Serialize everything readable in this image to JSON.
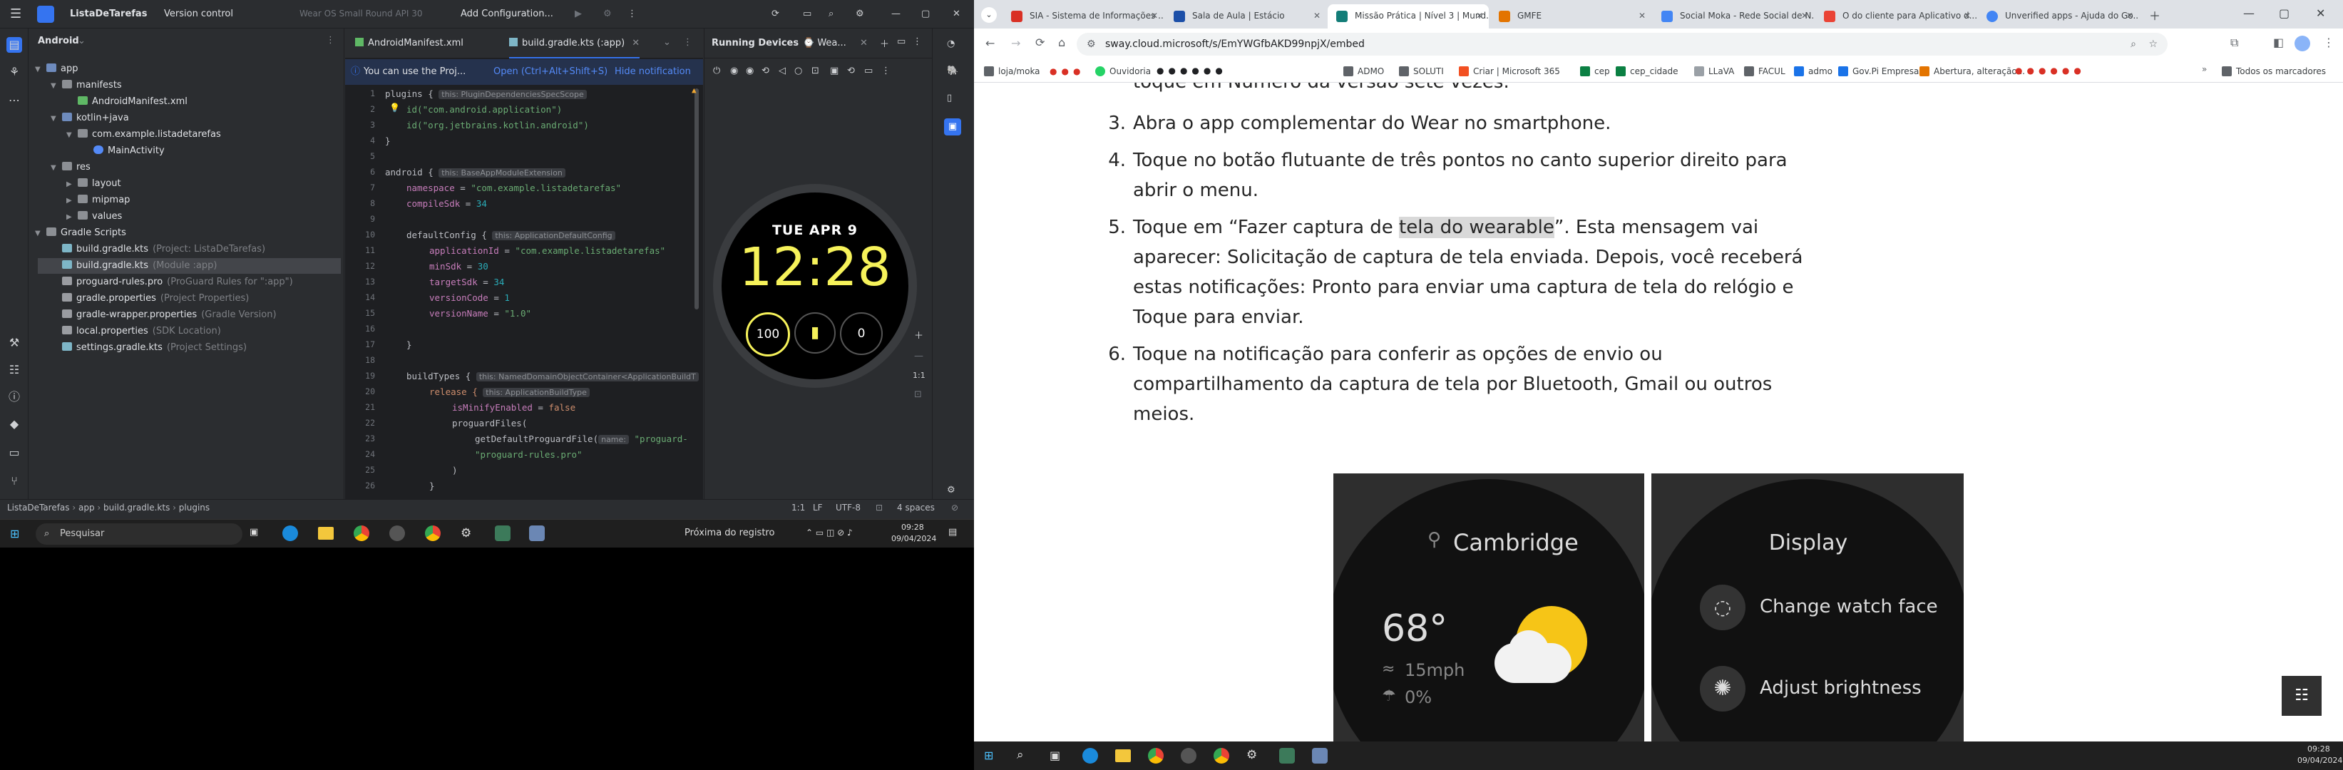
{
  "android_studio": {
    "title_bar": {
      "project": "ListaDeTarefas",
      "vcs": "Version control",
      "device": "Wear OS Small Round API 30",
      "run_config": "Add Configuration..."
    },
    "project_panel": {
      "view": "Android",
      "tree": [
        {
          "label": "app",
          "hint": ""
        },
        {
          "label": "manifests",
          "hint": ""
        },
        {
          "label": "AndroidManifest.xml",
          "hint": ""
        },
        {
          "label": "kotlin+java",
          "hint": ""
        },
        {
          "label": "com.example.listadetarefas",
          "hint": ""
        },
        {
          "label": "MainActivity",
          "hint": ""
        },
        {
          "label": "res",
          "hint": ""
        },
        {
          "label": "layout",
          "hint": ""
        },
        {
          "label": "mipmap",
          "hint": ""
        },
        {
          "label": "values",
          "hint": ""
        },
        {
          "label": "Gradle Scripts",
          "hint": ""
        },
        {
          "label": "build.gradle.kts",
          "hint": "(Project: ListaDeTarefas)"
        },
        {
          "label": "build.gradle.kts",
          "hint": "(Module :app)"
        },
        {
          "label": "proguard-rules.pro",
          "hint": "(ProGuard Rules for \":app\")"
        },
        {
          "label": "gradle.properties",
          "hint": "(Project Properties)"
        },
        {
          "label": "gradle-wrapper.properties",
          "hint": "(Gradle Version)"
        },
        {
          "label": "local.properties",
          "hint": "(SDK Location)"
        },
        {
          "label": "settings.gradle.kts",
          "hint": "(Project Settings)"
        }
      ]
    },
    "editor_tabs": [
      "AndroidManifest.xml",
      "build.gradle.kts (:app)"
    ],
    "notification": {
      "text": "You can use the Proj...",
      "action": "Open (Ctrl+Alt+Shift+S)",
      "hide": "Hide notification"
    },
    "code_lines": [
      "1",
      "2",
      "3",
      "4",
      "5",
      "6",
      "7",
      "8",
      "9",
      "10",
      "11",
      "12",
      "13",
      "14",
      "15",
      "16",
      "17",
      "18",
      "19",
      "20",
      "21",
      "22",
      "23",
      "24",
      "25",
      "26"
    ],
    "code": {
      "l1": "plugins {",
      "l1h": "this: PluginDependenciesSpecScope",
      "l2": "id(\"com.android.application\")",
      "l3": "id(\"org.jetbrains.kotlin.android\")",
      "l4": "}",
      "l6": "android {",
      "l6h": "this: BaseAppModuleExtension",
      "l7k": "namespace",
      "l7v": "\"com.example.listadetarefas\"",
      "l8k": "compileSdk",
      "l8v": "34",
      "l10": "defaultConfig {",
      "l10h": "this: ApplicationDefaultConfig",
      "l11k": "applicationId",
      "l11v": "\"com.example.listadetarefas\"",
      "l12k": "minSdk",
      "l12v": "30",
      "l13k": "targetSdk",
      "l13v": "34",
      "l14k": "versionCode",
      "l14v": "1",
      "l15k": "versionName",
      "l15v": "\"1.0\"",
      "l17": "}",
      "l19": "buildTypes {",
      "l19h": "this: NamedDomainObjectContainer<ApplicationBuildT",
      "l20": "release {",
      "l20h": "this: ApplicationBuildType",
      "l21k": "isMinifyEnabled",
      "l21v": "false",
      "l22": "proguardFiles(",
      "l23": "getDefaultProguardFile(",
      "l23h": "name:",
      "l23v": "\"proguard-",
      "l24": "\"proguard-rules.pro\"",
      "l25": ")",
      "l26": "}"
    },
    "running_devices": {
      "label": "Running Devices",
      "device_tab": "Wea...",
      "watch": {
        "date": "TUE APR 9",
        "time": "12:28",
        "left_comp": "100",
        "right_comp": "0"
      },
      "zoom": "1:1"
    },
    "status_bar": {
      "breadcrumb": [
        "ListaDeTarefas",
        "app",
        "build.gradle.kts",
        "plugins"
      ],
      "pos": "1:1",
      "lf": "LF",
      "enc": "UTF-8",
      "indent": "4 spaces"
    },
    "taskbar": {
      "search": "Pesquisar",
      "weather": "Próxima do registro",
      "time": "09:28",
      "date": "09/04/2024"
    }
  },
  "chrome": {
    "tabs": [
      "SIA - Sistema de Informações ...",
      "Sala de Aula | Estácio",
      "Missão Prática | Nível 3 | Mund...",
      "GMFE",
      "Social Moka - Rede Social de N...",
      "O do cliente para Aplicativo d...",
      "Unverified apps - Ajuda do Go..."
    ],
    "url": "sway.cloud.microsoft/s/EmYWGfbAKD99npjX/embed",
    "bookmarks": [
      "loja/moka",
      "Ouvidoria",
      "ADMO",
      "SOLUTI",
      "Criar | Microsoft 365",
      "cep",
      "cep_cidade",
      "LLaVA",
      "FACUL",
      "admo",
      "Gov.Pi Empresas",
      "Abertura, alteração...",
      "Todos os marcadores"
    ],
    "content": {
      "top_cut": "toque em Número da versão sete vezes.",
      "items": [
        {
          "num": "3.",
          "lines": [
            "Abra o app complementar do Wear no smartphone."
          ]
        },
        {
          "num": "4.",
          "lines": [
            "Toque no botão flutuante de três pontos no canto superior direito para",
            "abrir o menu."
          ]
        },
        {
          "num": "5.",
          "lines": [
            "Toque em “Fazer captura de tela do wearable”. Esta mensagem vai",
            "aparecer: Solicitação de captura de tela enviada. Depois, você receberá",
            "estas notificações: Pronto para enviar uma captura de tela do relógio e",
            "Toque para enviar."
          ]
        },
        {
          "num": "6.",
          "lines": [
            "Toque na notificação para conferir as opções de envio ou",
            "compartilhamento da captura de tela por Bluetooth, Gmail ou outros",
            "meios."
          ]
        }
      ],
      "line5_a": "Toque em “Fazer captura de ",
      "line5_hl": "tela do wearable",
      "line5_b": "”. Esta mensagem vai",
      "watch1": {
        "city": "Cambridge",
        "temp": "68°",
        "wind": "15mph",
        "rain": "0%"
      },
      "watch2": {
        "title": "Display",
        "item1": "Change watch face",
        "item2": "Adjust brightness"
      }
    },
    "taskbar": {
      "time": "09:28",
      "date": "09/04/2024"
    }
  },
  "colors": {
    "accent_blue": "#3574f0",
    "watch_yellow": "#f6f25a",
    "highlight": "#d9d9d9"
  }
}
